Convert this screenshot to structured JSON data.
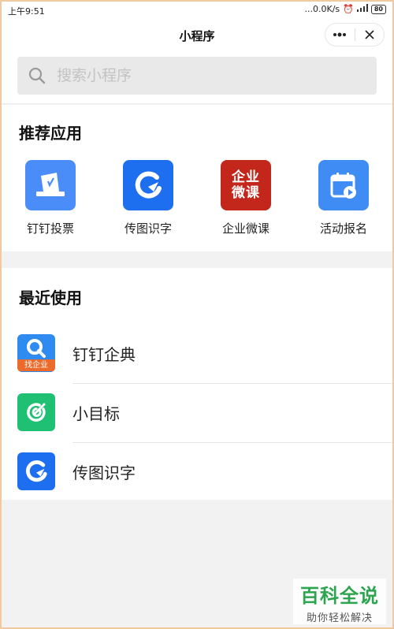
{
  "status_bar": {
    "time": "上午9:51",
    "network_speed": "...0.0K/s",
    "battery": "80"
  },
  "title_bar": {
    "title": "小程序",
    "more_icon": "more-dots-icon",
    "close_icon": "close-icon"
  },
  "search": {
    "placeholder": "搜索小程序"
  },
  "recommend": {
    "title": "推荐应用",
    "apps": [
      {
        "label": "钉钉投票",
        "icon": "vote-icon",
        "color": "#4a8df8"
      },
      {
        "label": "传图识字",
        "icon": "image-text-icon",
        "color": "#1e6ff0"
      },
      {
        "label": "企业微课",
        "icon": "micro-course-icon",
        "color": "#c3271b",
        "icon_text": "企业微课"
      },
      {
        "label": "活动报名",
        "icon": "calendar-icon",
        "color": "#3f8cf5"
      }
    ]
  },
  "recent": {
    "title": "最近使用",
    "items": [
      {
        "label": "钉钉企典",
        "icon": "enterprise-search-icon",
        "badge": "找企业"
      },
      {
        "label": "小目标",
        "icon": "target-icon",
        "color": "#1fbf74"
      },
      {
        "label": "传图识字",
        "icon": "image-text-icon",
        "color": "#1e6ff0"
      }
    ]
  },
  "watermark": {
    "main": "百科全说",
    "sub": "助你轻松解决"
  }
}
